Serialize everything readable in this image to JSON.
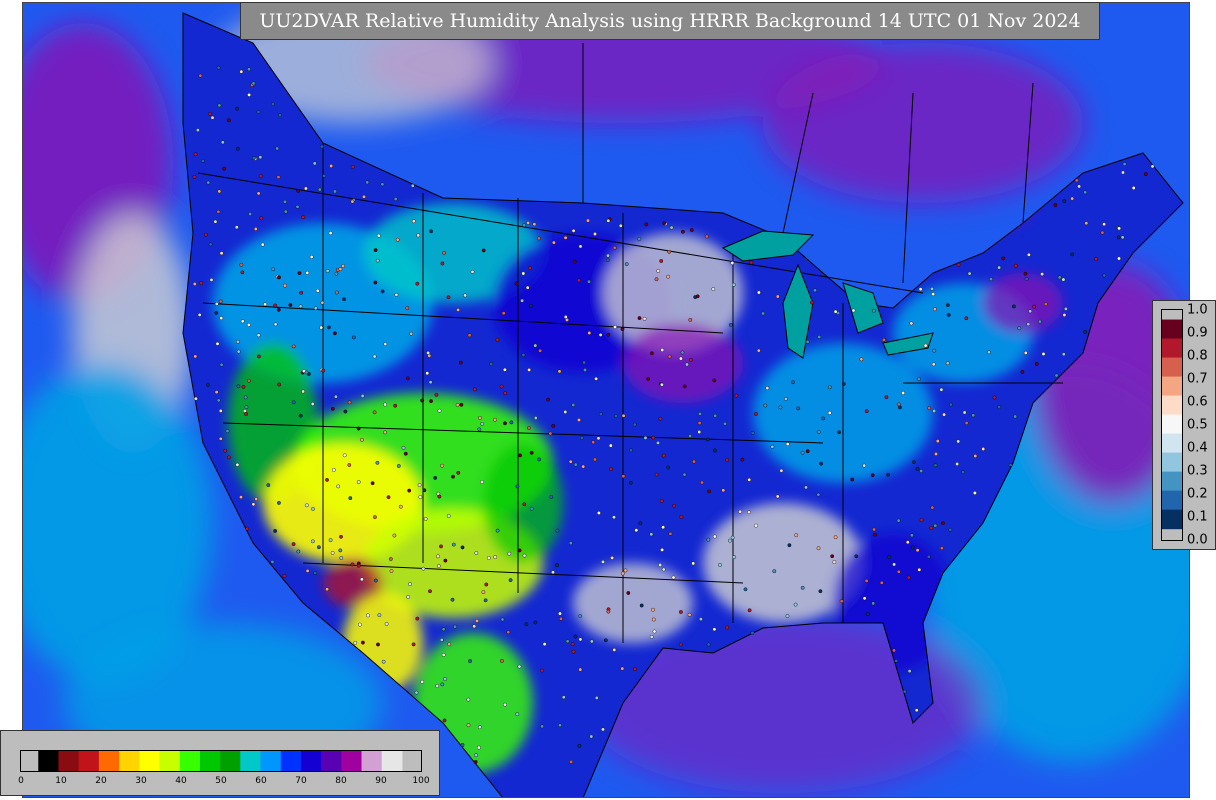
{
  "title": "UU2DVAR Relative Humidity Analysis using HRRR Background 14 UTC 01 Nov 2024",
  "rh_colorbar": {
    "ticks": [
      "0",
      "10",
      "20",
      "30",
      "40",
      "50",
      "60",
      "70",
      "80",
      "90",
      "100"
    ],
    "colors": [
      "#000000",
      "#8b0b12",
      "#c0141a",
      "#ff6a00",
      "#ffd400",
      "#ffff00",
      "#c8ff00",
      "#37ff00",
      "#00c800",
      "#00a000",
      "#00c8c8",
      "#0096ff",
      "#0032ff",
      "#1400d2",
      "#5a00b4",
      "#a000a0",
      "#d2a0d2",
      "#e6e6e6"
    ]
  },
  "obs_colorbar": {
    "ticks": [
      "1.0",
      "0.9",
      "0.8",
      "0.7",
      "0.6",
      "0.5",
      "0.4",
      "0.3",
      "0.2",
      "0.1",
      "0.0"
    ],
    "colors": [
      "#67001f",
      "#b2182b",
      "#d6604d",
      "#f4a582",
      "#fddbc7",
      "#f7f7f7",
      "#d1e5f0",
      "#92c5de",
      "#4393c3",
      "#2166ac",
      "#053061"
    ]
  },
  "map_colors": {
    "ocean": "#1f5af0",
    "humid_purple": "#8a14b4",
    "saturated_gray": "#d2d2d2",
    "moist_cyan": "#00a0e6",
    "dry_yellow": "#ffff00",
    "green": "#19d219",
    "borders": "#000000"
  }
}
